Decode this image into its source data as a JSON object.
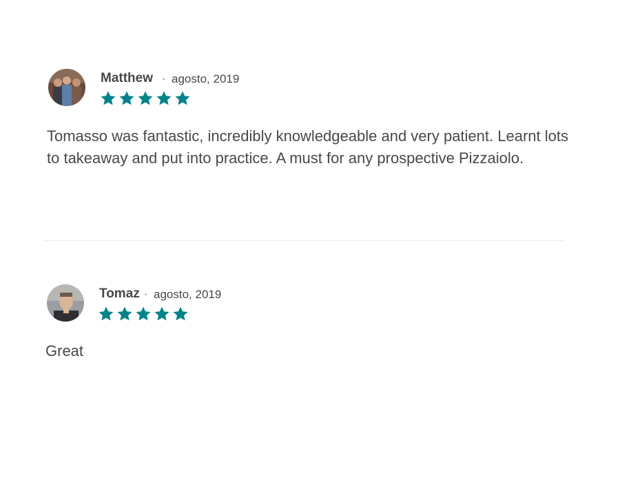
{
  "reviews": [
    {
      "name": "Matthew",
      "separator": "·",
      "date": "agosto, 2019",
      "rating": 5,
      "text": "Tomasso was fantastic, incredibly knowledgeable and very patient. Learnt lots to takeaway and put into practice. A must for any prospective Pizzaiolo."
    },
    {
      "name": "Tomaz",
      "separator": "·",
      "date": "agosto, 2019",
      "rating": 5,
      "text": "Great"
    }
  ],
  "colors": {
    "star": "#008489",
    "text": "#484848",
    "divider": "#ebebeb"
  }
}
